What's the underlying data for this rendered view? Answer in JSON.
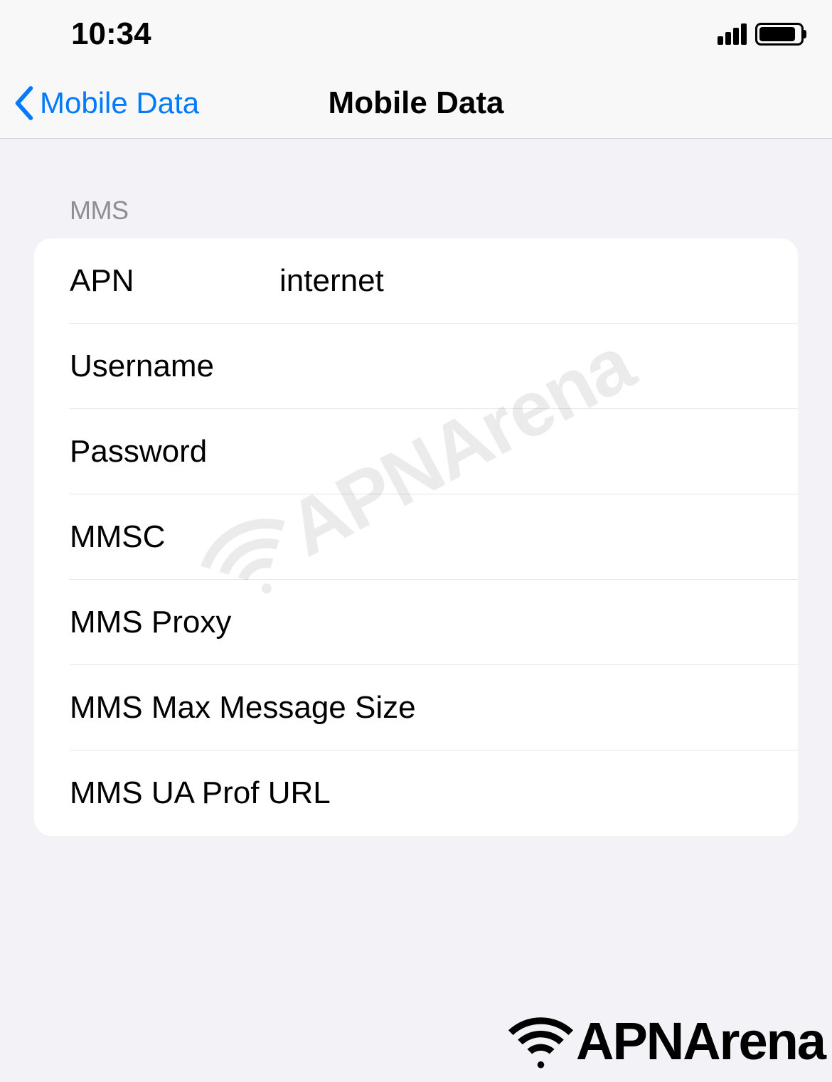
{
  "status": {
    "time": "10:34"
  },
  "nav": {
    "back_label": "Mobile Data",
    "title": "Mobile Data"
  },
  "section": {
    "header": "MMS",
    "rows": {
      "apn": {
        "label": "APN",
        "value": "internet"
      },
      "username": {
        "label": "Username",
        "value": ""
      },
      "password": {
        "label": "Password",
        "value": ""
      },
      "mmsc": {
        "label": "MMSC",
        "value": ""
      },
      "mms_proxy": {
        "label": "MMS Proxy",
        "value": ""
      },
      "mms_max": {
        "label": "MMS Max Message Size",
        "value": ""
      },
      "mms_ua": {
        "label": "MMS UA Prof URL",
        "value": ""
      }
    }
  },
  "brand": {
    "name": "APNArena"
  }
}
